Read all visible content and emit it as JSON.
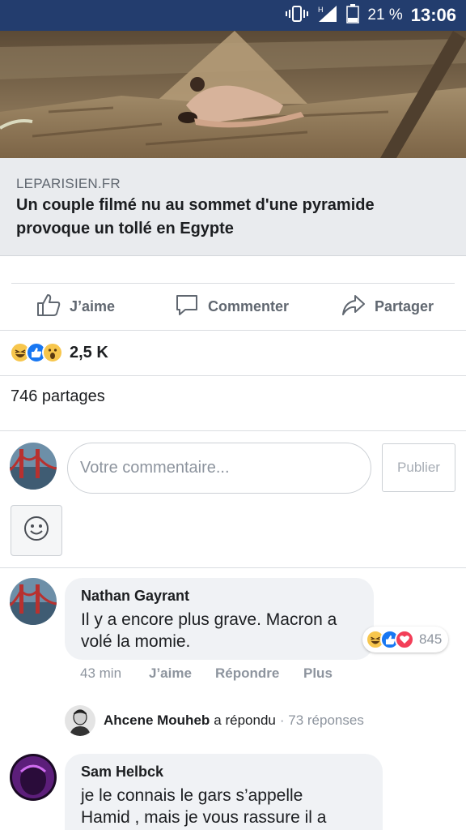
{
  "status_bar": {
    "battery_percent": "21 %",
    "time": "13:06"
  },
  "link": {
    "domain": "LEPARISIEN.FR",
    "title": "Un couple filmé nu au sommet d'une pyramide provoque un tollé en Egypte"
  },
  "actions": {
    "like": "J’aime",
    "comment": "Commenter",
    "share": "Partager"
  },
  "reactions": {
    "icons": [
      "haha-icon",
      "like-icon",
      "wow-icon"
    ],
    "count": "2,5 K"
  },
  "shares": "746 partages",
  "composer": {
    "placeholder": "Votre commentaire...",
    "publish": "Publier"
  },
  "comments": [
    {
      "author": "Nathan Gayrant",
      "text": "Il y a encore plus grave. Macron a volé la momie.",
      "reaction_icons": [
        "haha-icon",
        "like-icon",
        "love-icon"
      ],
      "reaction_count": "845",
      "time": "43 min",
      "like": "J’aime",
      "reply": "Répondre",
      "more": "Plus",
      "reply_summary": {
        "author": "Ahcene Mouheb",
        "verb": "a répondu",
        "count": "· 73 réponses"
      }
    },
    {
      "author": "Sam Helbck",
      "text": "je le connais le gars s’appelle Hamid , mais je vous rassure il a"
    }
  ],
  "colors": {
    "status_bar": "#233d6e",
    "like_blue": "#1877f2",
    "love_red": "#f33e58",
    "haha_yellow": "#f7c64d"
  }
}
